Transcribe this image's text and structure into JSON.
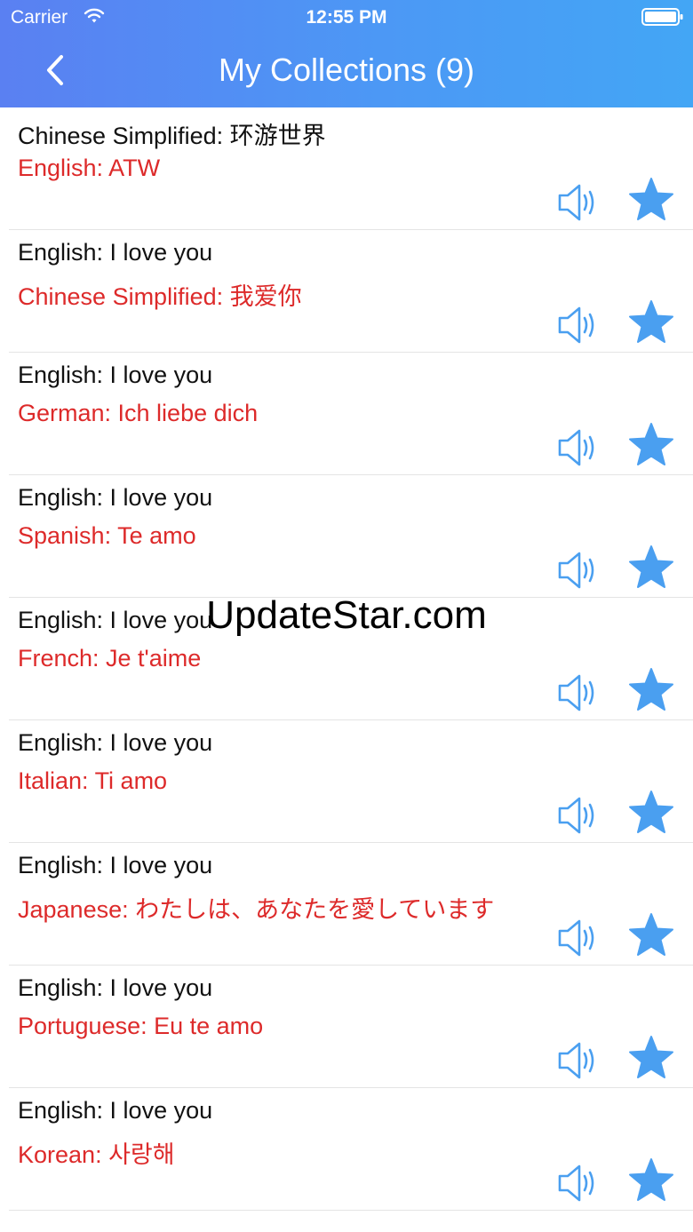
{
  "status_bar": {
    "carrier": "Carrier",
    "time": "12:55 PM"
  },
  "nav": {
    "title": "My Collections (9)",
    "back_icon": "chevron-left-icon"
  },
  "colors": {
    "header_start": "#5a80f2",
    "header_end": "#43a6f5",
    "target_text": "#dd2a2a",
    "icon_blue": "#4a9ff0"
  },
  "items": [
    {
      "source": "Chinese Simplified: 环游世界",
      "target": "English: ATW"
    },
    {
      "source": "English: I love you",
      "target": "Chinese Simplified: 我爱你"
    },
    {
      "source": "English: I love you",
      "target": "German: Ich liebe dich"
    },
    {
      "source": "English: I love you",
      "target": "Spanish: Te amo"
    },
    {
      "source": "English: I love you",
      "target": "French: Je t'aime"
    },
    {
      "source": "English: I love you",
      "target": "Italian: Ti amo"
    },
    {
      "source": "English: I love you",
      "target": "Japanese: わたしは、あなたを愛しています"
    },
    {
      "source": "English: I love you",
      "target": "Portuguese: Eu te amo"
    },
    {
      "source": "English: I love you",
      "target": "Korean: 사랑해"
    }
  ],
  "row_icons": {
    "speak": "speaker-icon",
    "favorite": "star-icon"
  },
  "watermark": "UpdateStar.com"
}
